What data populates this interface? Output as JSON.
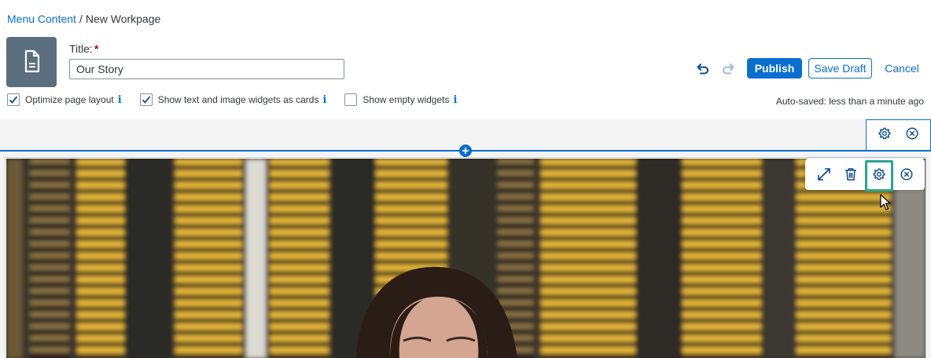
{
  "breadcrumb": {
    "parent": "Menu Content",
    "separator": "/",
    "current": "New Workpage"
  },
  "page_icon": "document-icon",
  "title_field": {
    "label": "Title:",
    "required_mark": "*",
    "value": "Our Story"
  },
  "actions": {
    "undo_icon": "undo-icon",
    "redo_icon": "redo-icon",
    "publish": "Publish",
    "save_draft": "Save Draft",
    "cancel": "Cancel"
  },
  "options": [
    {
      "label": "Optimize page layout",
      "checked": true,
      "info": "i"
    },
    {
      "label": "Show text and image widgets as cards",
      "checked": true,
      "info": "i"
    },
    {
      "label": "Show empty widgets",
      "checked": false,
      "info": "i"
    }
  ],
  "autosave": "Auto-saved: less than a minute ago",
  "section_toolbar": {
    "settings_icon": "gear-icon",
    "close_icon": "close-icon"
  },
  "widget_toolbar": {
    "expand_icon": "expand-icon",
    "delete_icon": "trash-icon",
    "settings_icon": "gear-icon",
    "close_icon": "close-icon"
  },
  "colors": {
    "accent": "#0a6ed1",
    "focus": "#2aa58e",
    "page_icon_bg": "#5b6e7d",
    "required": "#bb0000"
  }
}
